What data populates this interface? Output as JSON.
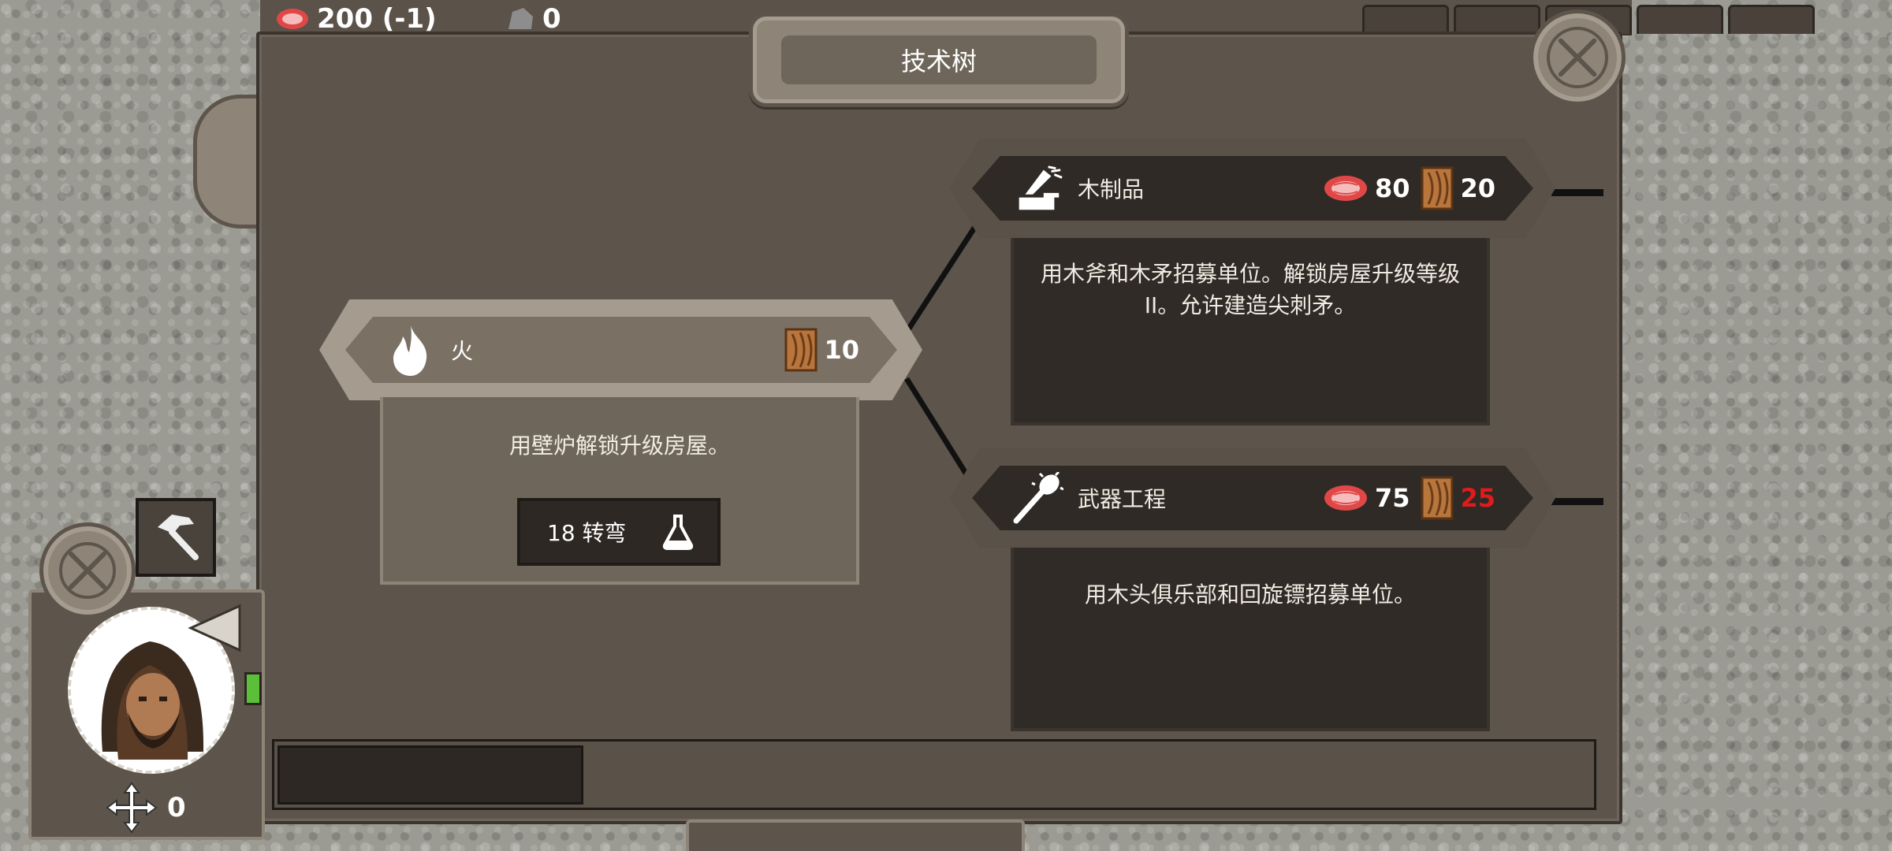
{
  "top_bar": {
    "meat_value": "200 (-1)",
    "stone_value": "0"
  },
  "panel": {
    "title": "技术树"
  },
  "nodes": {
    "fire": {
      "label": "火",
      "wood_cost": "10",
      "description": "用壁炉解锁升级房屋。",
      "turns_label": "18 转弯"
    },
    "woodwork": {
      "label": "木制品",
      "meat_cost": "80",
      "wood_cost": "20",
      "description": "用木斧和木矛招募单位。解锁房屋升级等级II。允许建造尖刺矛。"
    },
    "weapon": {
      "label": "武器工程",
      "meat_cost": "75",
      "wood_cost": "25",
      "wood_cost_insufficient": true,
      "description": "用木头俱乐部和回旋镖招募单位。"
    }
  },
  "unit": {
    "move_points": "0"
  },
  "colors": {
    "insufficient": "#e01b1b",
    "panel": "#5d554b",
    "plate": "#8e8578"
  },
  "icons": [
    "meat-icon",
    "wood-icon",
    "fire-icon",
    "anvil-icon",
    "club-icon",
    "flask-icon",
    "hammer-icon",
    "close-icon",
    "move-icon"
  ]
}
